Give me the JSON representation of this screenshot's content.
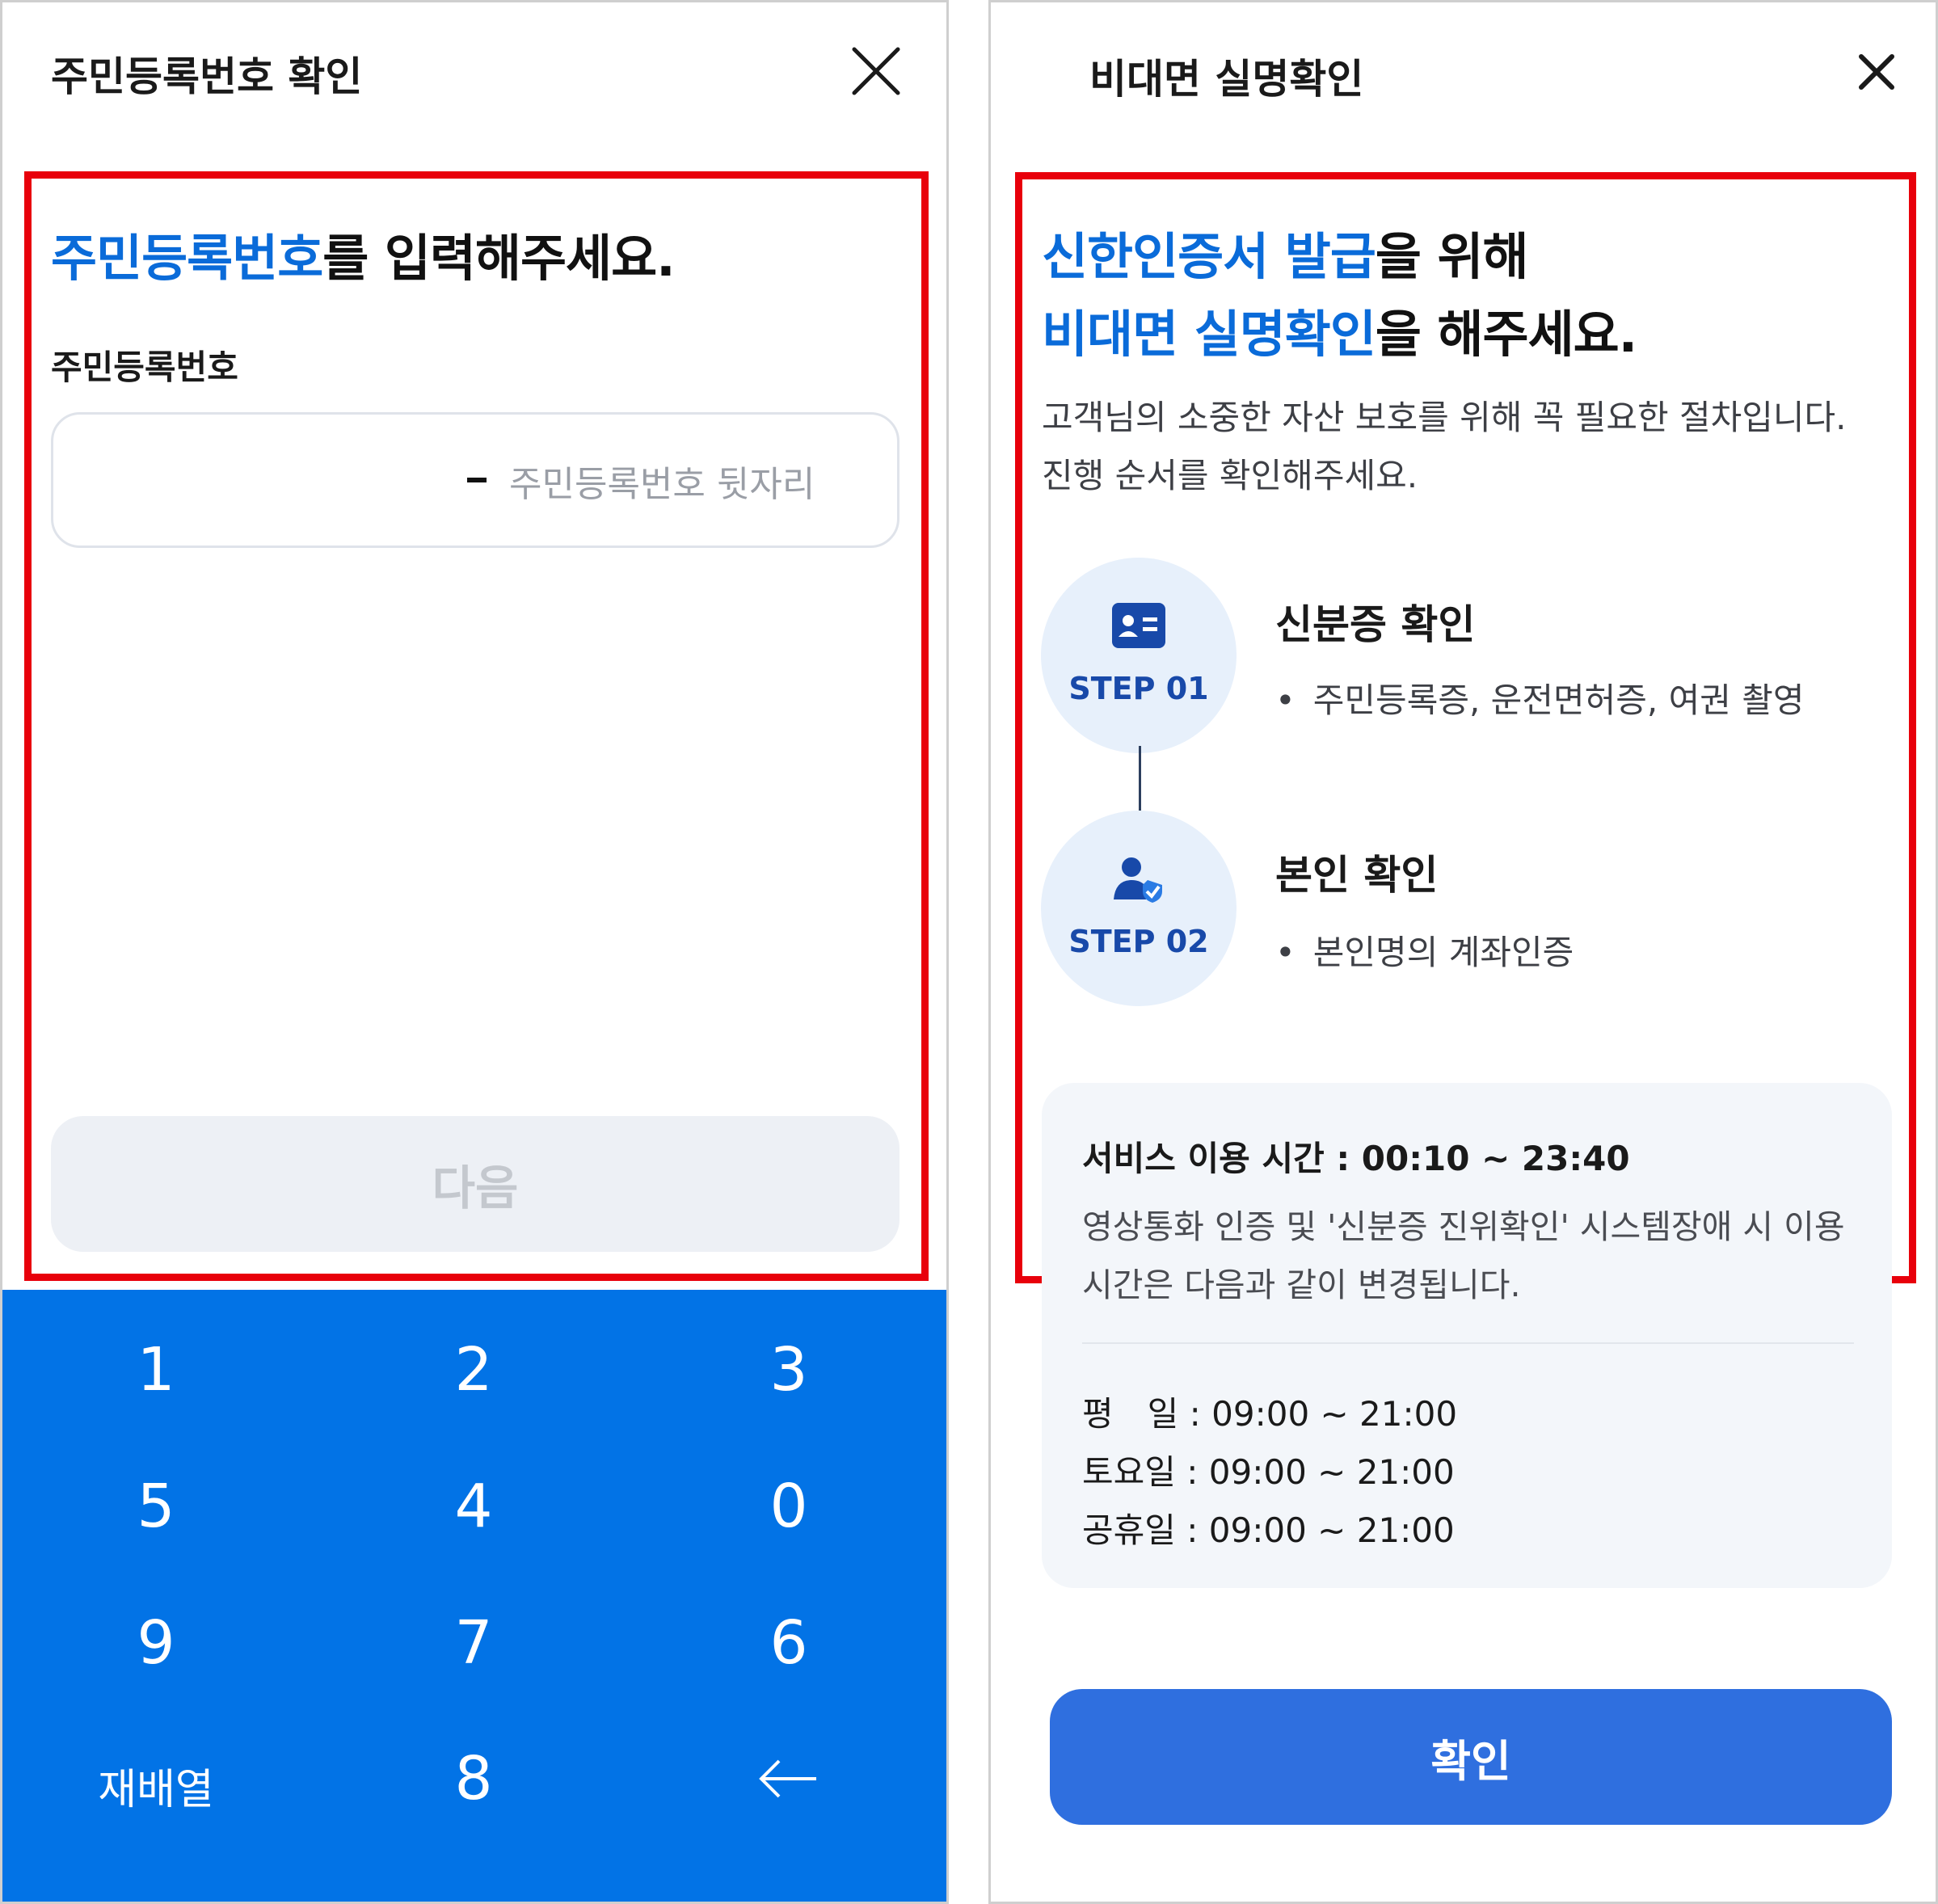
{
  "left": {
    "header_title": "주민등록번호 확인",
    "headline_blue": "주민등록번호",
    "headline_rest": "를 입력해주세요.",
    "field_label": "주민등록번호",
    "ssn_placeholder": "주민등록번호 뒷자리",
    "next_label": "다음",
    "keypad": {
      "rows": [
        [
          "1",
          "2",
          "3"
        ],
        [
          "5",
          "4",
          "0"
        ],
        [
          "9",
          "7",
          "6"
        ],
        [
          "재배열",
          "8",
          "←"
        ]
      ]
    }
  },
  "right": {
    "header_title": "비대면 실명확인",
    "headline_line1_blue": "신한인증서 발급",
    "headline_line1_rest": "을 위해",
    "headline_line2_blue": "비대면 실명확인",
    "headline_line2_rest": "을 해주세요.",
    "description": "고객님의 소중한 자산 보호를 위해 꼭 필요한 절차입니다. 진행 순서를 확인해주세요.",
    "steps": [
      {
        "label": "STEP 01",
        "title": "신분증 확인",
        "bullet": "주민등록증, 운전면허증, 여권 촬영",
        "icon": "id-card-icon"
      },
      {
        "label": "STEP 02",
        "title": "본인 확인",
        "bullet": "본인명의 계좌인증",
        "icon": "user-verified-icon"
      }
    ],
    "service": {
      "title": "서비스 이용 시간 : 00:10 ~ 23:40",
      "description": "영상통화 인증 및 '신분증 진위확인' 시스템장애 시 이용시간은 다음과 같이 변경됩니다.",
      "schedule": [
        "평　일 : 09:00 ~ 21:00",
        "토요일 : 09:00 ~ 21:00",
        "공휴일 : 09:00 ~ 21:00"
      ]
    },
    "confirm_label": "확인"
  },
  "colors": {
    "accent_blue": "#0a6bd9",
    "keypad_blue": "#0273e6",
    "button_blue": "#2f6fdf",
    "highlight_red": "#e8000b",
    "step_blue": "#1849a9"
  }
}
